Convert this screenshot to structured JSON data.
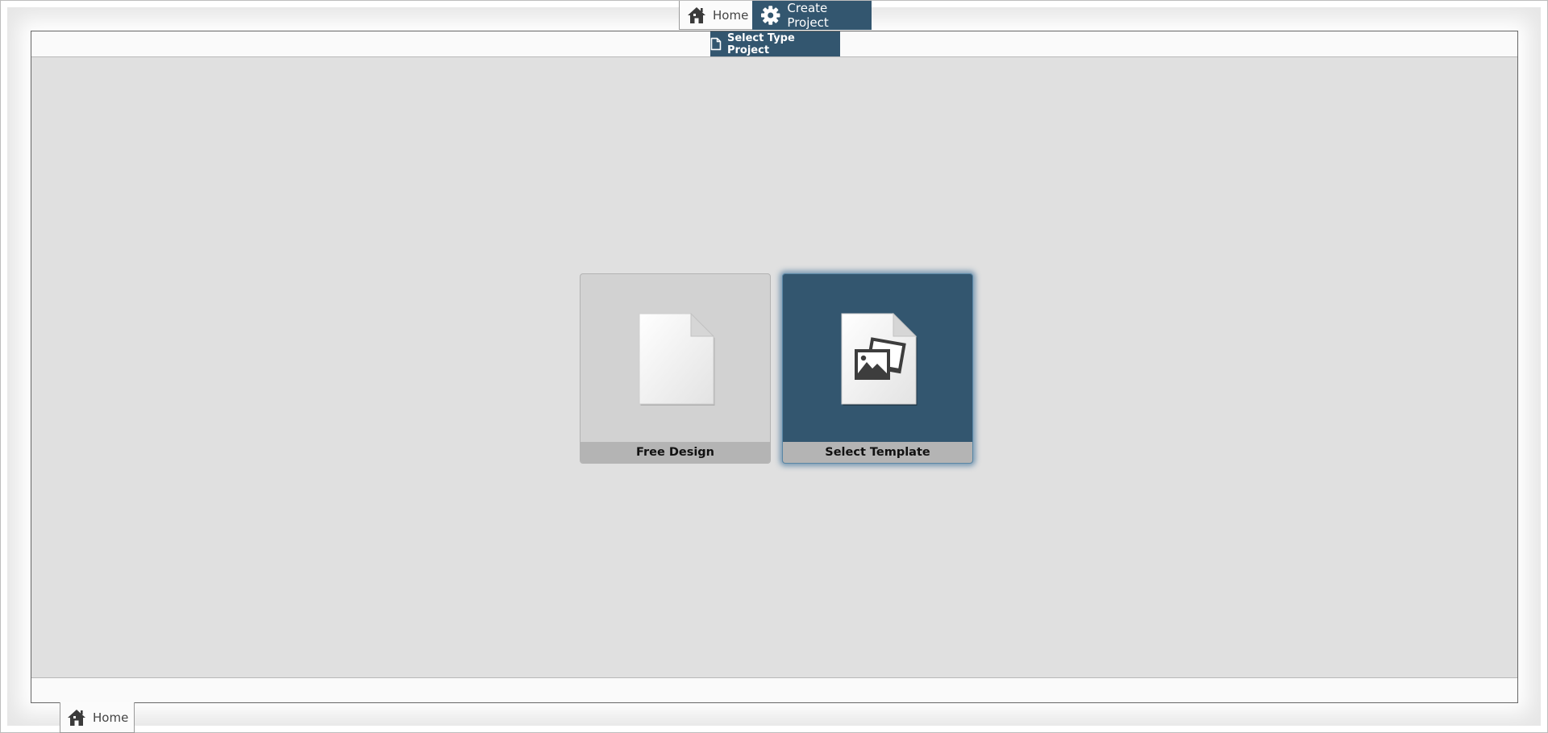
{
  "top_tabs": [
    {
      "label": "Home",
      "icon": "home-icon"
    },
    {
      "label": "Create Project",
      "icon": "gear-icon",
      "active": true
    }
  ],
  "sub_tab": {
    "label": "Select Type Project",
    "icon": "document-icon"
  },
  "options": [
    {
      "label": "Free Design",
      "icon": "blank-page-icon",
      "selected": false
    },
    {
      "label": "Select Template",
      "icon": "template-page-icon",
      "selected": true
    }
  ],
  "bottom_tab": {
    "label": "Home",
    "icon": "home-icon"
  },
  "colors": {
    "accent": "#33566f",
    "panel_bg": "#e0e0e0",
    "card_bg": "#d2d2d2",
    "label_bar": "#b4b4b4"
  }
}
